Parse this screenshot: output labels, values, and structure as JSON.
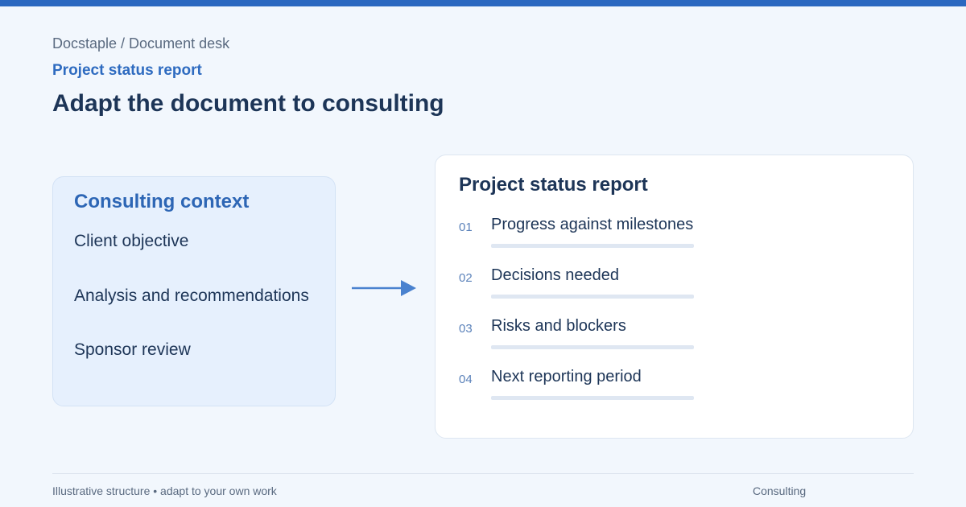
{
  "header": {
    "breadcrumb": "Docstaple / Document desk",
    "eyebrow": "Project status report",
    "title": "Adapt the document to consulting"
  },
  "context": {
    "title": "Consulting context",
    "items": [
      "Client objective",
      "Analysis and recommendations",
      "Sponsor review"
    ]
  },
  "report": {
    "title": "Project status report",
    "rows": [
      {
        "num": "01",
        "label": "Progress against milestones"
      },
      {
        "num": "02",
        "label": "Decisions needed"
      },
      {
        "num": "03",
        "label": "Risks and blockers"
      },
      {
        "num": "04",
        "label": "Next reporting period"
      }
    ]
  },
  "footer": {
    "note": "Illustrative structure • adapt to your own work",
    "tag": "Consulting"
  },
  "colors": {
    "accent": "#2b68c0",
    "background": "#f2f7fd",
    "context_card": "#e6f0fd",
    "heading": "#1d3557"
  },
  "icons": {
    "arrow": "arrow-right-icon"
  }
}
